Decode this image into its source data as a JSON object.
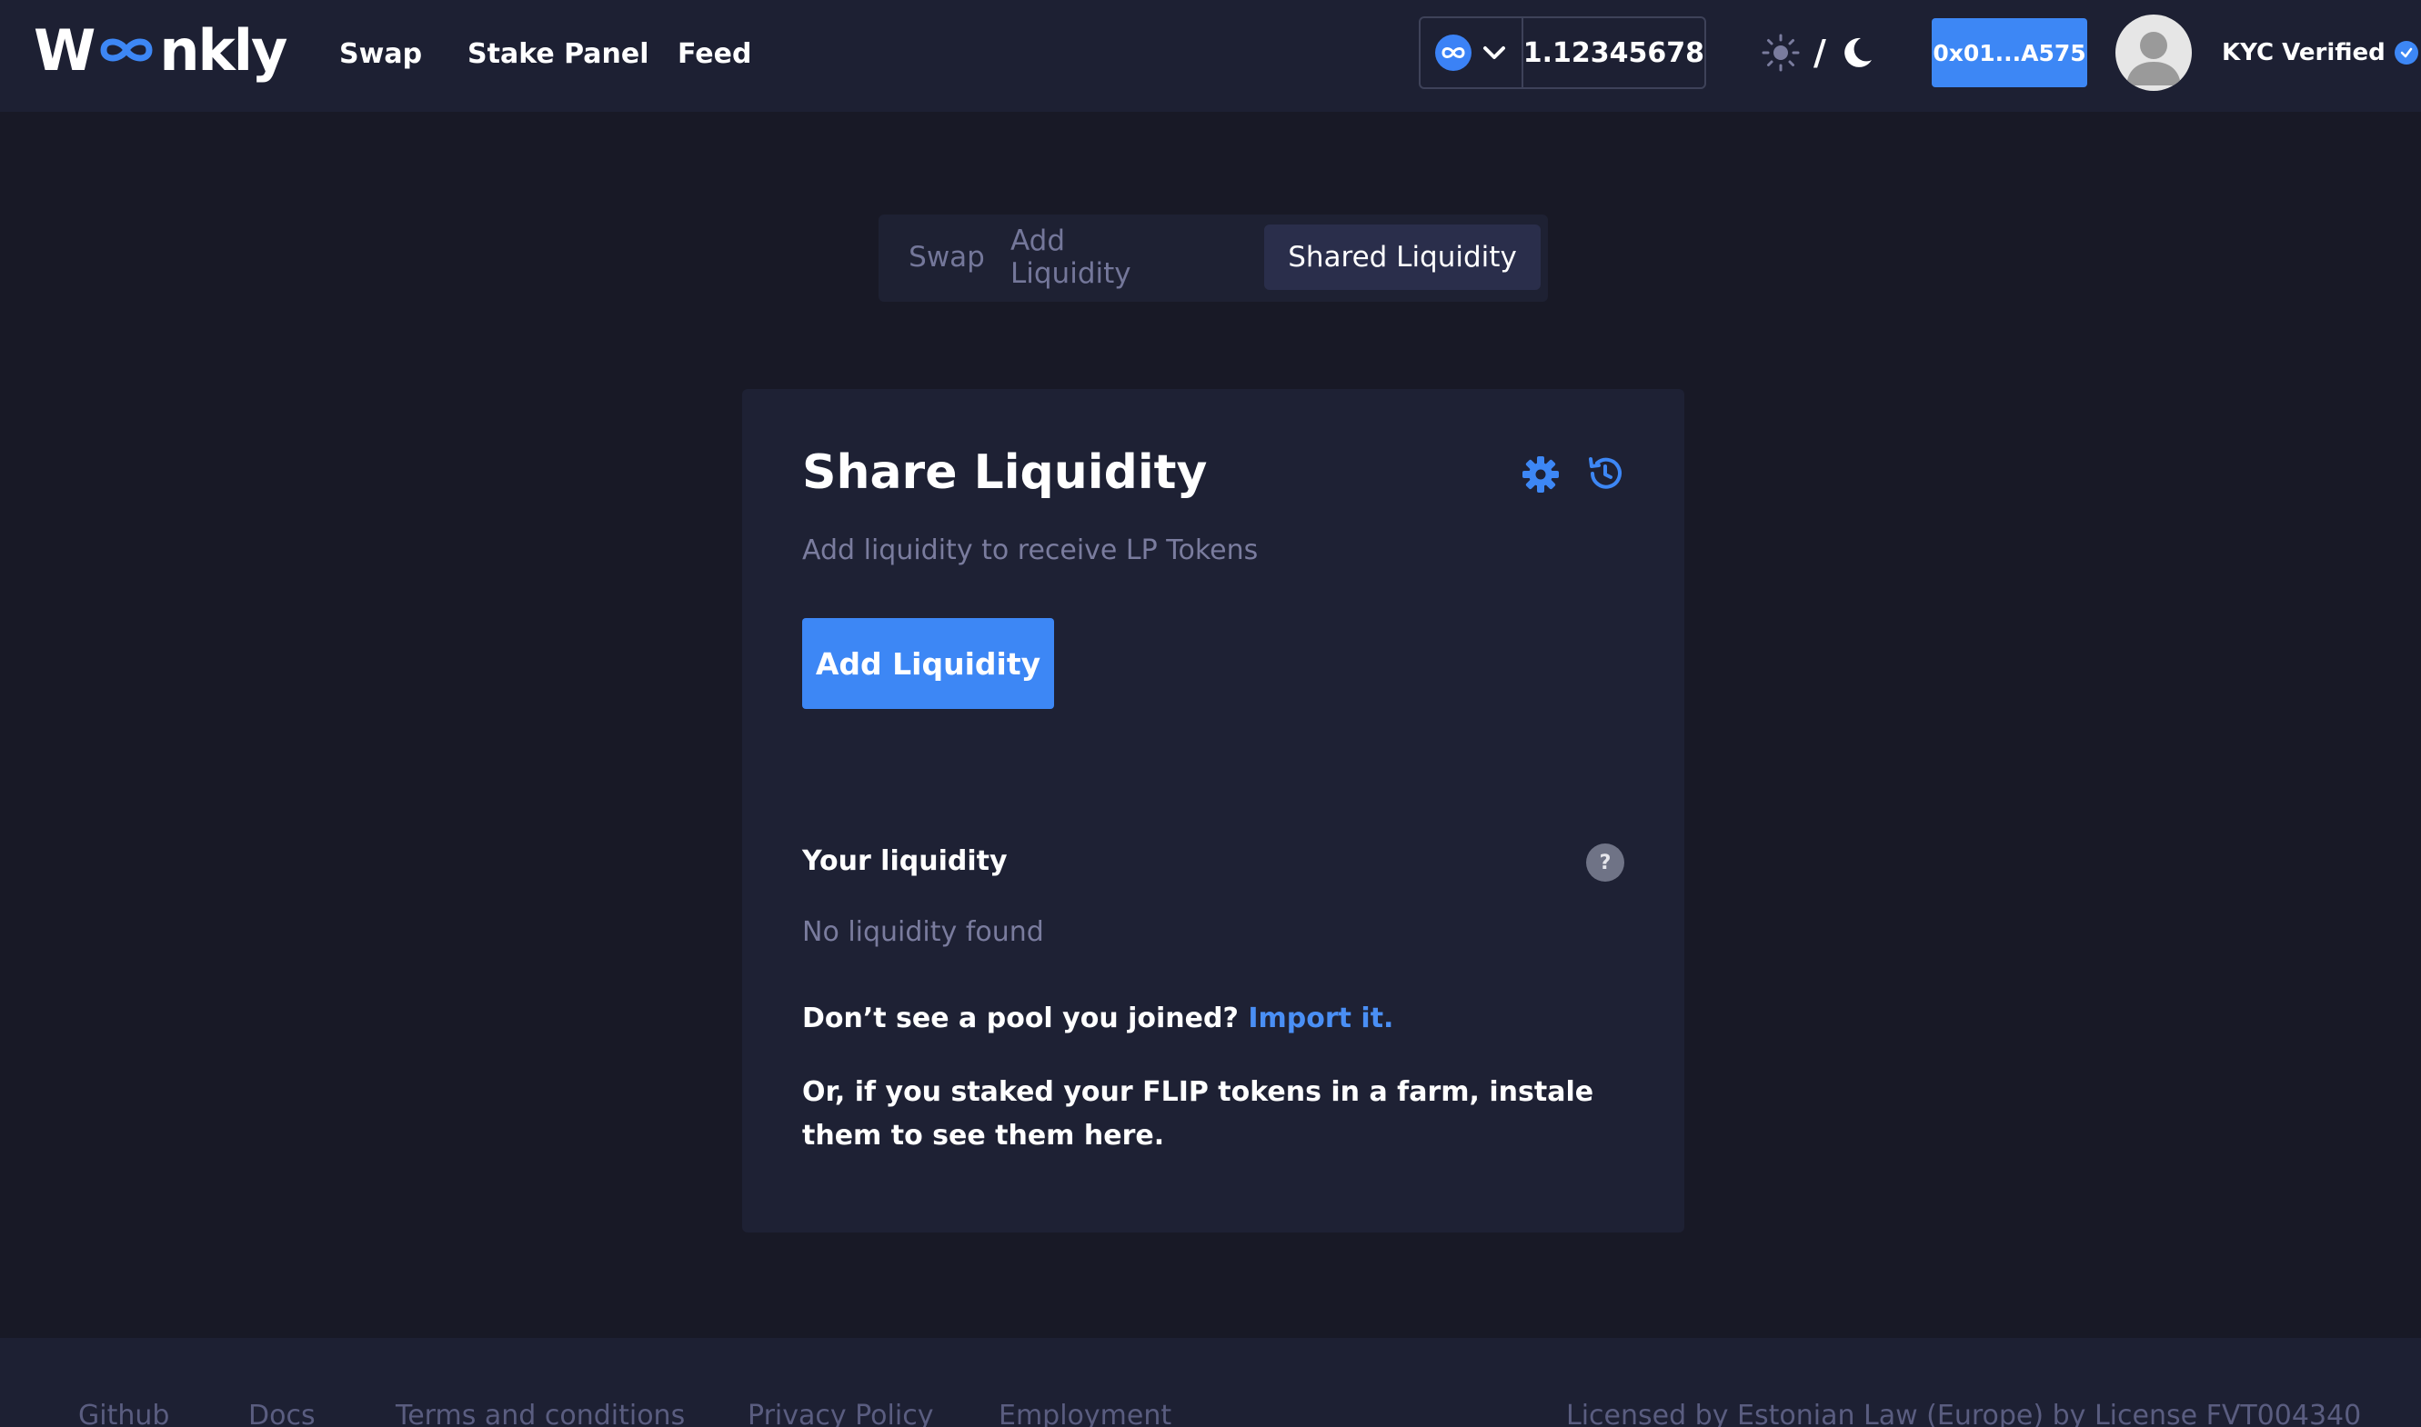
{
  "header": {
    "logo_text": "Woonkly",
    "nav": [
      "Swap",
      "Stake Panel",
      "Feed"
    ],
    "network_balance": "1.12345678",
    "theme_separator": "/",
    "wallet_address": "0x01...A575",
    "kyc_label": "KYC Verified"
  },
  "tabs": [
    "Swap",
    "Add Liquidity",
    "Shared Liquidity"
  ],
  "active_tab": "Shared Liquidity",
  "card": {
    "title": "Share Liquidity",
    "subtitle": "Add liquidity to receive LP Tokens",
    "add_button": "Add Liquidity",
    "your_liquidity": "Your liquidity",
    "help_icon": "?",
    "no_liquidity": "No liquidity found",
    "import_prompt": "Don’t see a pool you joined?",
    "import_link": "Import it.",
    "staked_text": "Or, if you staked your FLIP tokens in a farm, instale them to see them here."
  },
  "footer": {
    "links": [
      "Github",
      "Docs",
      "Terms and conditions",
      "Privacy Policy",
      "Employment"
    ],
    "license": "Licensed by Estonian Law (Europe) by License FVT004340"
  },
  "colors": {
    "background": "#181926",
    "header": "#1d2033",
    "card": "#1e2134",
    "accent": "#3d87f5",
    "muted_text": "#7a7c9e"
  },
  "icons": [
    "network-infinity-icon",
    "chevron-down-icon",
    "sun-icon",
    "moon-icon",
    "avatar-icon",
    "verified-check-icon",
    "gear-icon",
    "history-icon",
    "help-icon"
  ]
}
